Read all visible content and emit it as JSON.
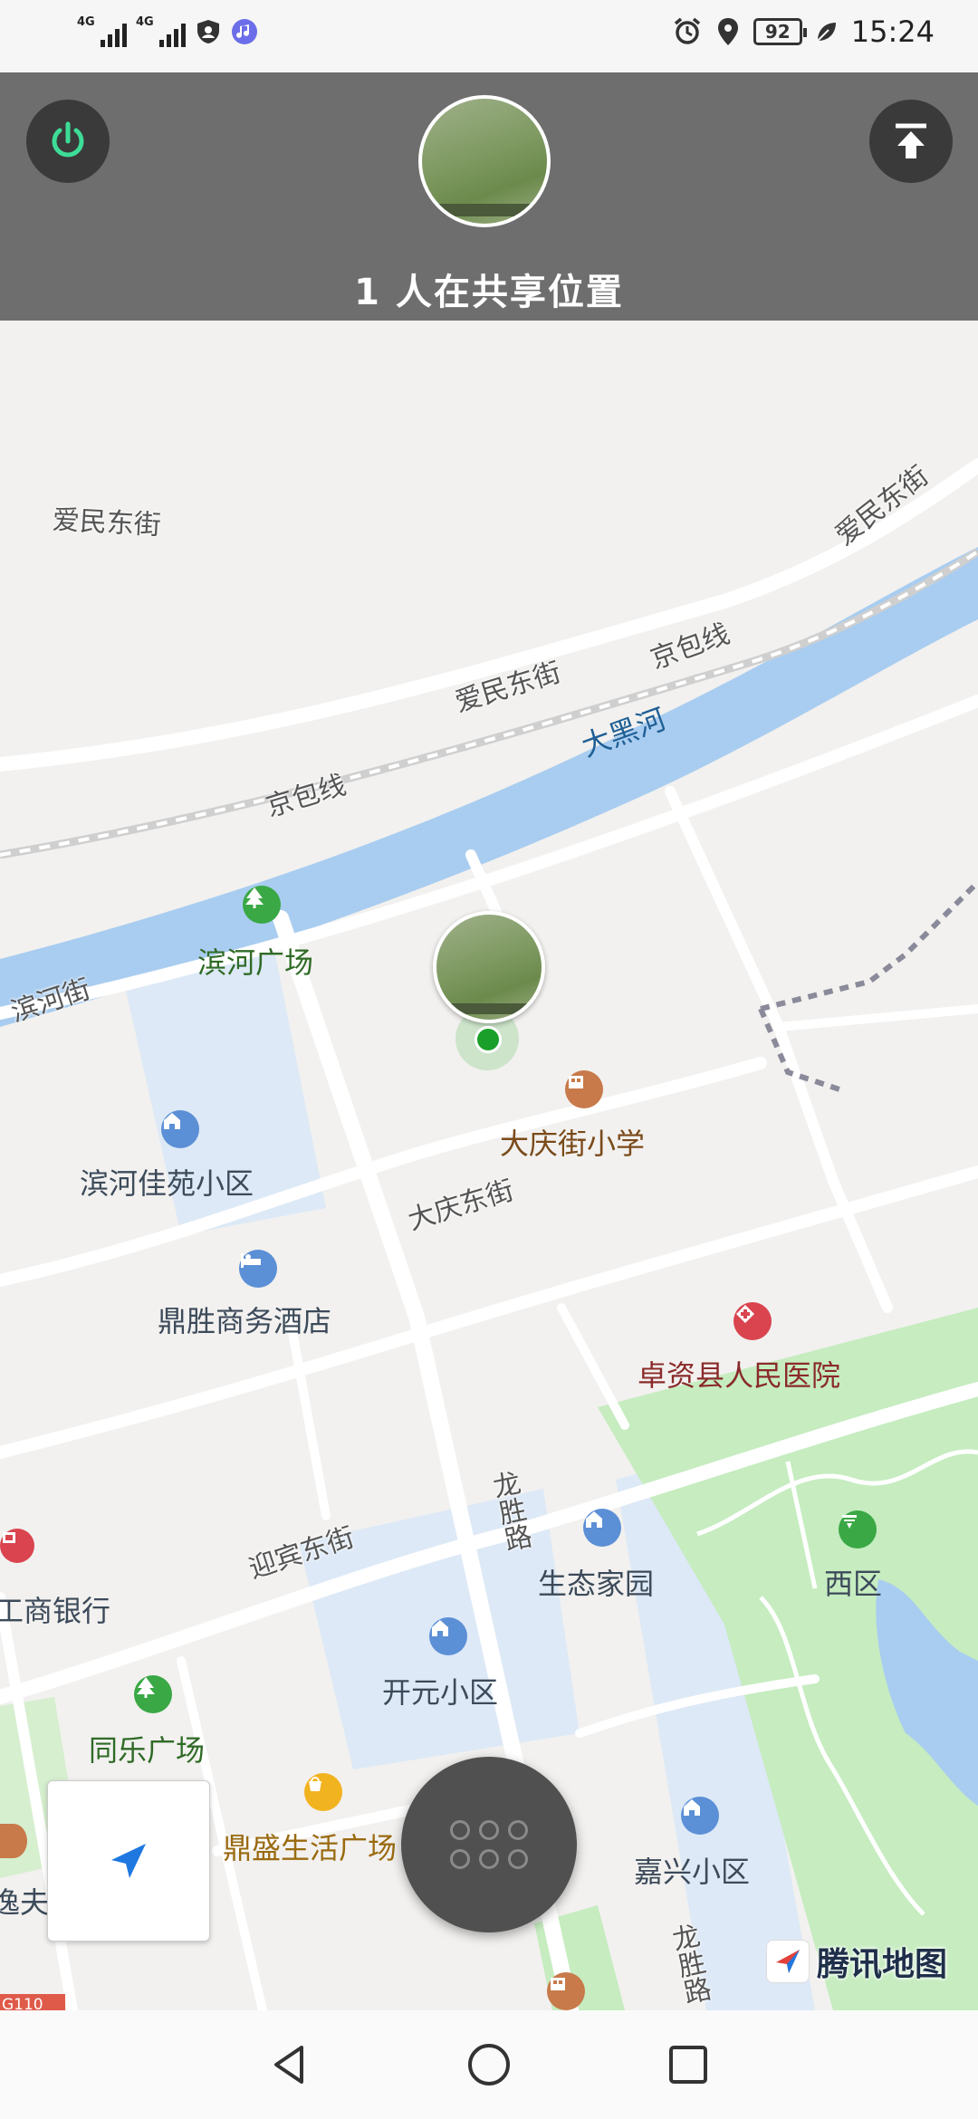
{
  "status_bar": {
    "network_1": "4G",
    "network_2": "4G",
    "battery": "92",
    "time": "15:24"
  },
  "share_bar": {
    "title": "1 人在共享位置"
  },
  "map": {
    "roads": {
      "aimin_1": "爱民东街",
      "aimin_2": "爱民东街",
      "aimin_3": "爱民东街",
      "jingbao_1": "京包线",
      "jingbao_2": "京包线",
      "binhe_street": "滨河街",
      "daqing_street": "大庆东街",
      "yingbin_street": "迎宾东街",
      "longsheng_1": "龙胜路",
      "longsheng_2": "龙胜路",
      "g110": "G110"
    },
    "river": "大黑河",
    "pois": {
      "binhe_square": "滨河广场",
      "binhe_jiayuan": "滨河佳苑小区",
      "dingsheng_hotel": "鼎胜商务酒店",
      "daqing_school": "大庆街小学",
      "hospital": "卓资县人民医院",
      "icbc": "工商银行",
      "tongle_square": "同乐广场",
      "kaiyuan": "开元小区",
      "shengtai": "生态家园",
      "xiqu": "西区",
      "dingsheng_plaza": "鼎盛生活广场",
      "jiaxing": "嘉兴小区",
      "school_partial": "逸夫学校"
    }
  },
  "brand": "腾讯地图",
  "colors": {
    "share_bar": "#6e6e6e",
    "power_accent": "#3ddc97",
    "river": "#a9cdf0",
    "park": "#c6ecc0",
    "residential": "#dde9f6",
    "location_dot": "#1aa02a"
  },
  "icons": [
    "power-icon",
    "upload-icon",
    "locate-arrow-icon",
    "grid-menu-icon",
    "back-icon",
    "home-icon",
    "recents-icon"
  ]
}
